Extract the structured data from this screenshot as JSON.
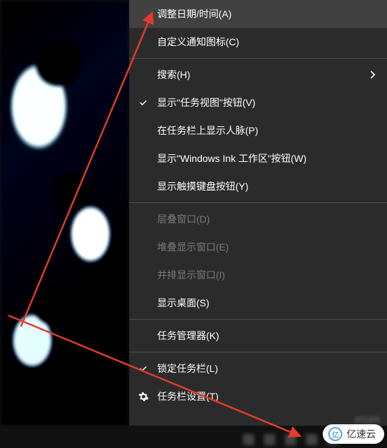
{
  "menu": {
    "groups": [
      [
        {
          "key": "adjust-datetime",
          "label": "调整日期/时间(A)",
          "highlighted": true
        },
        {
          "key": "customize-notif-icons",
          "label": "自定义通知图标(C)"
        }
      ],
      [
        {
          "key": "search",
          "label": "搜索(H)",
          "hasSubmenu": true
        },
        {
          "key": "show-taskview-button",
          "label": "显示\"任务视图\"按钮(V)",
          "checked": true
        },
        {
          "key": "show-people",
          "label": "在任务栏上显示人脉(P)"
        },
        {
          "key": "show-ink-workspace",
          "label": "显示\"Windows Ink 工作区\"按钮(W)"
        },
        {
          "key": "show-touch-keyboard",
          "label": "显示触摸键盘按钮(Y)"
        }
      ],
      [
        {
          "key": "cascade-windows",
          "label": "层叠窗口(D)",
          "disabled": true
        },
        {
          "key": "stack-windows",
          "label": "堆叠显示窗口(E)",
          "disabled": true
        },
        {
          "key": "sidebyside-windows",
          "label": "并排显示窗口(I)",
          "disabled": true
        },
        {
          "key": "show-desktop",
          "label": "显示桌面(S)"
        }
      ],
      [
        {
          "key": "task-manager",
          "label": "任务管理器(K)"
        }
      ],
      [
        {
          "key": "lock-taskbar",
          "label": "锁定任务栏(L)",
          "checked": true
        },
        {
          "key": "taskbar-settings",
          "label": "任务栏设置(T)",
          "icon": "gear"
        }
      ]
    ]
  },
  "watermark": {
    "text": "亿速云"
  },
  "tray": {
    "date_partial": "2018/6"
  },
  "arrows": {
    "color": "#e23b2e"
  }
}
